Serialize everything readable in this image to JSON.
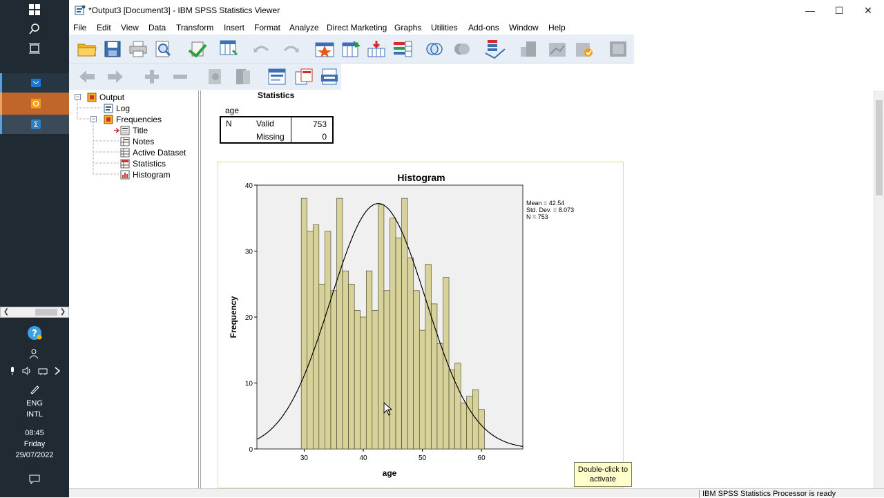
{
  "taskbar": {
    "language": "ENG",
    "layout": "INTL",
    "time": "08:45",
    "day": "Friday",
    "date": "29/07/2022"
  },
  "window": {
    "title": "*Output3 [Document3] - IBM SPSS Statistics Viewer",
    "minimize": "—",
    "maximize": "☐",
    "close": "✕"
  },
  "menu": {
    "items": [
      "File",
      "Edit",
      "View",
      "Data",
      "Transform",
      "Insert",
      "Format",
      "Analyze",
      "Direct Marketing",
      "Graphs",
      "Utilities",
      "Add-ons",
      "Window",
      "Help"
    ]
  },
  "outline": {
    "root": "Output",
    "log": "Log",
    "frequencies": "Frequencies",
    "children": [
      "Title",
      "Notes",
      "Active Dataset",
      "Statistics",
      "Histogram"
    ]
  },
  "statistics": {
    "title": "Statistics",
    "variable": "age",
    "n_label": "N",
    "valid_label": "Valid",
    "valid_value": "753",
    "missing_label": "Missing",
    "missing_value": "0"
  },
  "chart_data": {
    "type": "bar",
    "title": "Histogram",
    "xlabel": "age",
    "ylabel": "Frequency",
    "xlim": [
      22,
      67
    ],
    "ylim": [
      0,
      40
    ],
    "x_ticks": [
      30,
      40,
      50,
      60
    ],
    "y_ticks": [
      0,
      10,
      20,
      30,
      40
    ],
    "bin_width": 1,
    "bins": [
      {
        "x": 30,
        "y": 38
      },
      {
        "x": 31,
        "y": 33
      },
      {
        "x": 32,
        "y": 34
      },
      {
        "x": 33,
        "y": 25
      },
      {
        "x": 34,
        "y": 33
      },
      {
        "x": 35,
        "y": 24
      },
      {
        "x": 36,
        "y": 38
      },
      {
        "x": 37,
        "y": 27
      },
      {
        "x": 38,
        "y": 25
      },
      {
        "x": 39,
        "y": 21
      },
      {
        "x": 40,
        "y": 20
      },
      {
        "x": 41,
        "y": 27
      },
      {
        "x": 42,
        "y": 21
      },
      {
        "x": 43,
        "y": 37
      },
      {
        "x": 44,
        "y": 24
      },
      {
        "x": 45,
        "y": 35
      },
      {
        "x": 46,
        "y": 32
      },
      {
        "x": 47,
        "y": 38
      },
      {
        "x": 48,
        "y": 29
      },
      {
        "x": 49,
        "y": 24
      },
      {
        "x": 50,
        "y": 18
      },
      {
        "x": 51,
        "y": 28
      },
      {
        "x": 52,
        "y": 22
      },
      {
        "x": 53,
        "y": 16
      },
      {
        "x": 54,
        "y": 26
      },
      {
        "x": 55,
        "y": 12
      },
      {
        "x": 56,
        "y": 13
      },
      {
        "x": 57,
        "y": 7
      },
      {
        "x": 58,
        "y": 8
      },
      {
        "x": 59,
        "y": 9
      },
      {
        "x": 60,
        "y": 6
      }
    ],
    "normal_curve": {
      "mean": 42.54,
      "sd": 8.073,
      "n": 753
    },
    "legend": [
      "Mean = 42.54",
      "Std. Dev. = 8.073",
      "N = 753"
    ],
    "legend_placement": "top-right",
    "grid": false,
    "bar_color": "#d6d29a",
    "plot_bg": "#f0f0f0"
  },
  "tooltip": {
    "line1": "Double-click to",
    "line2": "activate"
  },
  "status": {
    "text": "IBM SPSS Statistics Processor is ready"
  }
}
